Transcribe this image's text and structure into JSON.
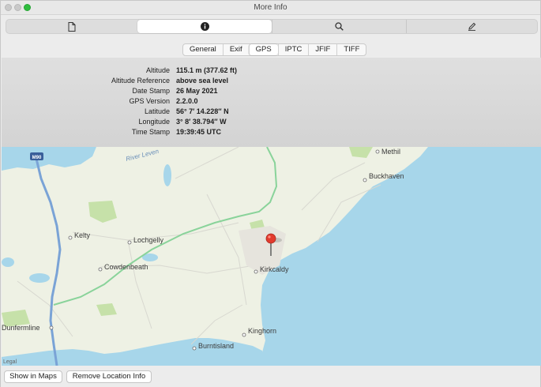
{
  "window": {
    "title": "More Info"
  },
  "toolbar": [
    {
      "name": "general-icon"
    },
    {
      "name": "info-icon"
    },
    {
      "name": "search-icon"
    },
    {
      "name": "pencil-icon"
    }
  ],
  "tabs": [
    {
      "label": "General"
    },
    {
      "label": "Exif"
    },
    {
      "label": "GPS",
      "active": true
    },
    {
      "label": "IPTC"
    },
    {
      "label": "JFIF"
    },
    {
      "label": "TIFF"
    }
  ],
  "gps": [
    {
      "key": "Altitude",
      "value": "115.1 m (377.62 ft)"
    },
    {
      "key": "Altitude Reference",
      "value": "above sea level"
    },
    {
      "key": "Date Stamp",
      "value": "26 May 2021"
    },
    {
      "key": "GPS Version",
      "value": "2.2.0.0"
    },
    {
      "key": "Latitude",
      "value": "56° 7′ 14.228″ N"
    },
    {
      "key": "Longitude",
      "value": "3° 8′ 38.794″ W"
    },
    {
      "key": "Time Stamp",
      "value": "19:39:45 UTC"
    }
  ],
  "map": {
    "places": [
      "Methil",
      "Buckhaven",
      "Kelty",
      "Lochgelly",
      "Cowdenbeath",
      "Kirkcaldy",
      "Dunfermline",
      "Kinghorn",
      "Burntisland"
    ],
    "river": "River Leven",
    "road_shield": "M90",
    "legal": "Legal",
    "colors": {
      "sea": "#a7d6ea",
      "land": "#eef1e4",
      "park": "#c6e1a9",
      "motorway": "#7aa3d6",
      "main_road": "#89d39a",
      "pin": "#e23b2e"
    }
  },
  "buttons": {
    "show_in_maps": "Show in Maps",
    "remove_location": "Remove Location Info"
  }
}
